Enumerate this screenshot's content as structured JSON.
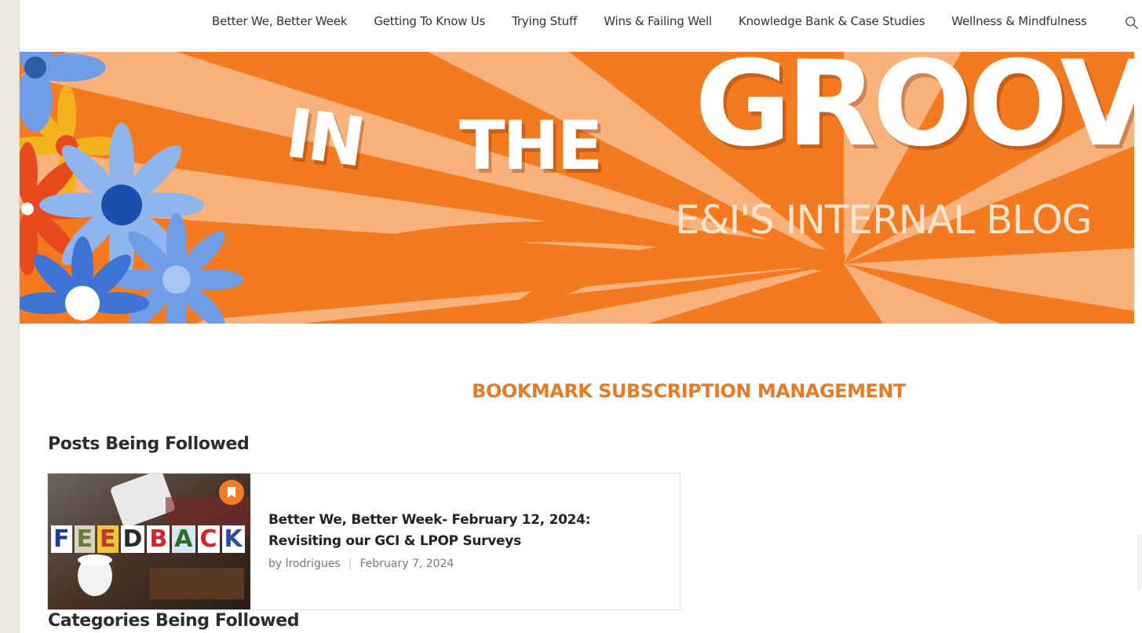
{
  "nav": {
    "items": [
      "Better We, Better Week",
      "Getting To Know Us",
      "Trying Stuff",
      "Wins & Failing Well",
      "Knowledge Bank & Case Studies",
      "Wellness & Mindfulness"
    ],
    "search_icon": "search-icon"
  },
  "banner": {
    "title_word1": "IN",
    "title_word2": "THE",
    "title_word3": "GROOVE",
    "subtitle": "E&I'S INTERNAL BLOG",
    "colors": {
      "orange": "#f47a1f",
      "peach": "#f9b27c",
      "white": "#ffffff"
    }
  },
  "page": {
    "title": "BOOKMARK SUBSCRIPTION MANAGEMENT",
    "accent": "#e87a23"
  },
  "posts_section": {
    "heading": "Posts Being Followed",
    "posts": [
      {
        "title": "Better We, Better Week- February 12, 2024: Revisiting our GCI & LPOP Surveys",
        "by": "by lrodrigues",
        "date": "February 7, 2024",
        "thumb_letters": [
          "F",
          "E",
          "E",
          "D",
          "B",
          "A",
          "C",
          "K"
        ],
        "badge_icon": "bookmark-icon"
      }
    ]
  },
  "categories_section": {
    "heading": "Categories Being Followed"
  }
}
